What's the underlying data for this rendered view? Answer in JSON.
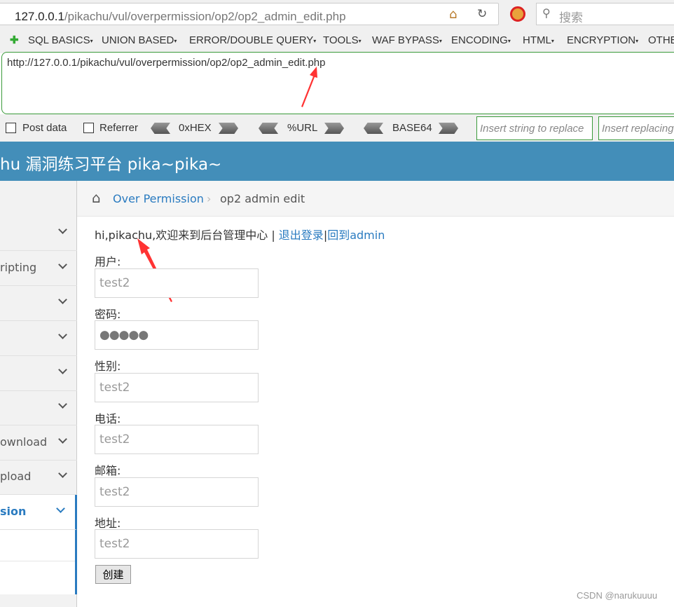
{
  "browser": {
    "url_host": "127.0.0.1",
    "url_path": "/pikachu/vul/overpermission/op2/op2_admin_edit.php",
    "search_placeholder": "搜索"
  },
  "hackbar": {
    "menus": [
      "SQL BASICS",
      "UNION BASED",
      "ERROR/DOUBLE QUERY",
      "TOOLS",
      "WAF BYPASS",
      "ENCODING",
      "HTML",
      "ENCRYPTION",
      "OTHE"
    ],
    "url_value": "http://127.0.0.1/pikachu/vul/overpermission/op2/op2_admin_edit.php",
    "post_data": "Post data",
    "referrer": "Referrer",
    "hex": "0xHEX",
    "url_enc": "%URL",
    "base64": "BASE64",
    "insert_placeholder": "Insert string to replace",
    "insert_replacing_placeholder": "Insert replacing string"
  },
  "header": {
    "title": "hu 漏洞练习平台 pika~pika~"
  },
  "sidebar": {
    "items": [
      "",
      "ripting",
      "",
      "",
      "",
      "",
      "ownload",
      "pload",
      "sion"
    ]
  },
  "breadcrumb": {
    "parent": "Over Permission",
    "current": "op2 admin edit"
  },
  "main": {
    "welcome": "hi,pikachu,欢迎来到后台管理中心 | ",
    "logout": "退出登录",
    "sep": "|",
    "back": "回到admin",
    "fields": [
      {
        "label": "用户:",
        "value": "test2"
      },
      {
        "label": "密码:",
        "value": "●●●●●"
      },
      {
        "label": "性别:",
        "value": "test2"
      },
      {
        "label": "电话:",
        "value": "test2"
      },
      {
        "label": "邮箱:",
        "value": "test2"
      },
      {
        "label": "地址:",
        "value": "test2"
      }
    ],
    "submit": "创建"
  },
  "watermark": "CSDN @narukuuuu",
  "colors": {
    "header": "#438eb9",
    "link": "#2a7bc0",
    "annotation_arrow": "#ff3333"
  }
}
